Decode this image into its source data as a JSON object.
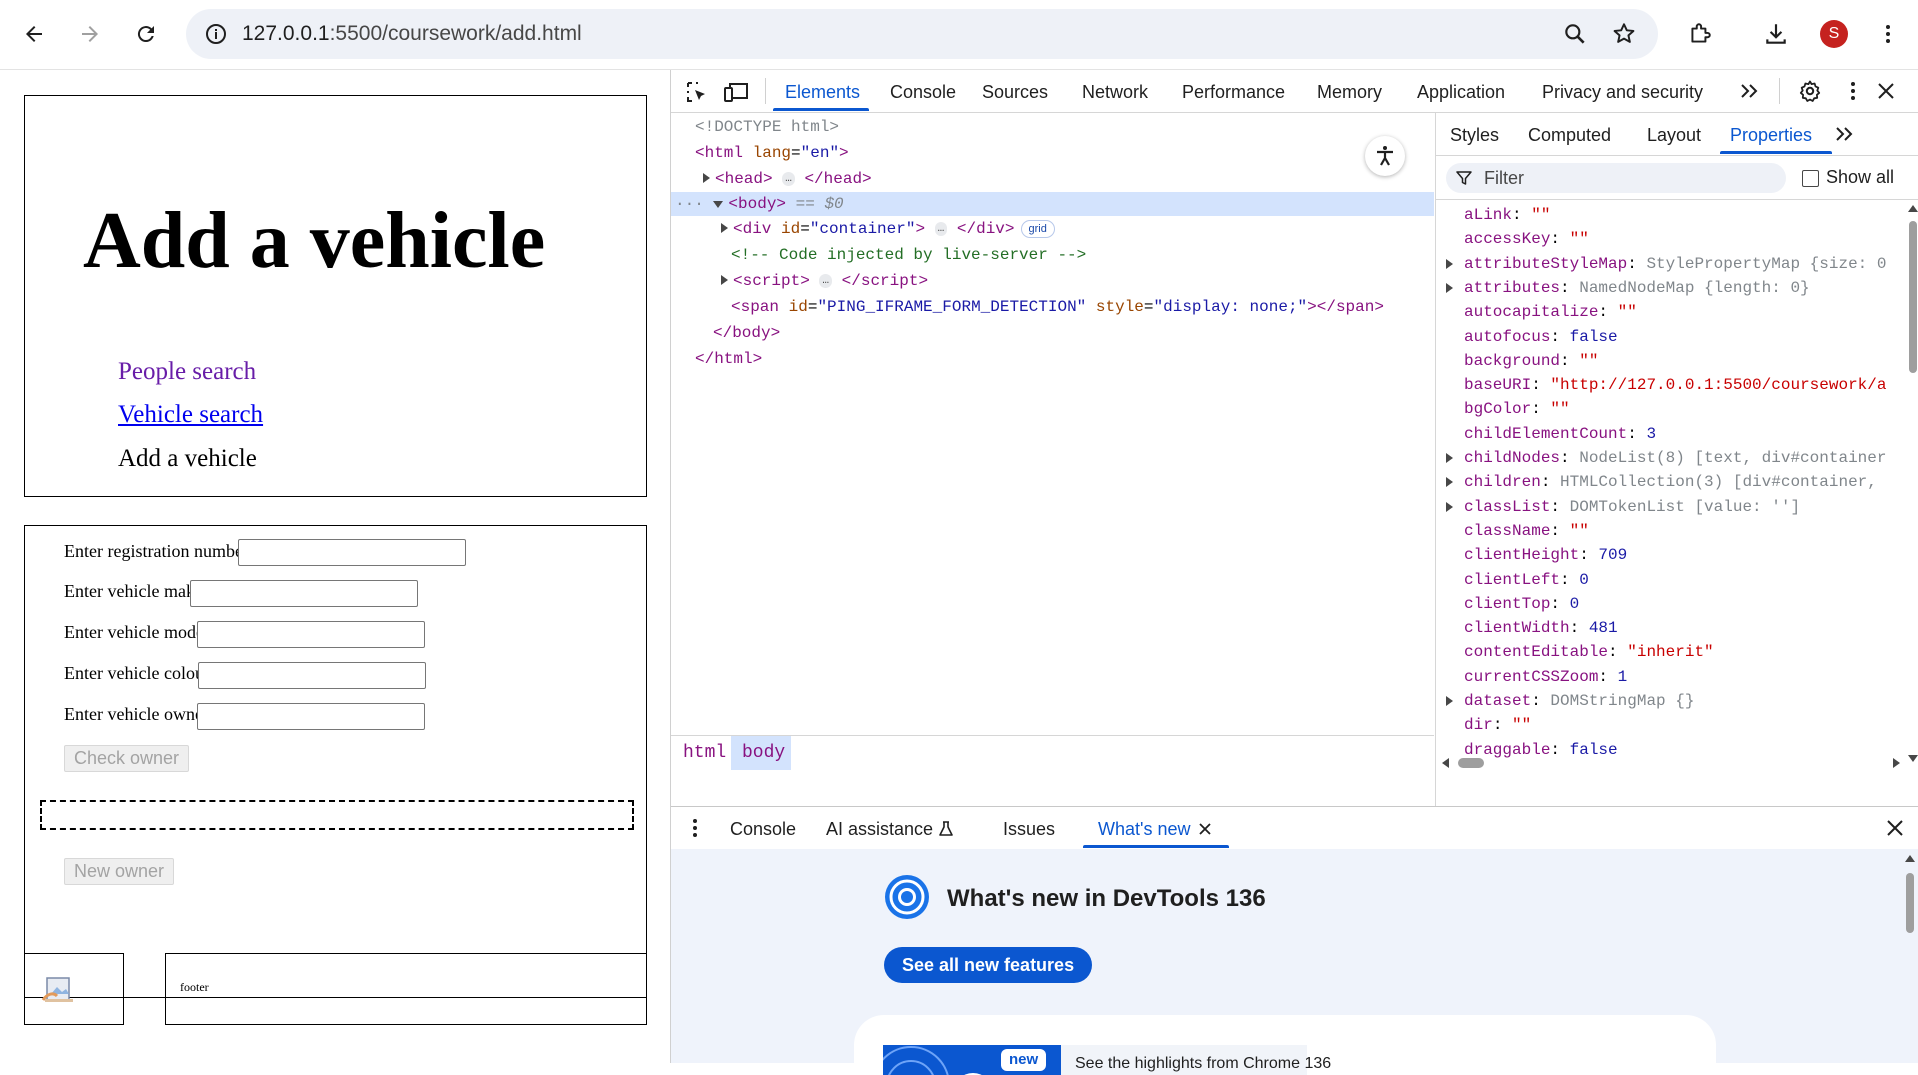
{
  "browser": {
    "url_host": "127.0.0.1",
    "url_path": ":5500/coursework/add.html",
    "profile_initial": "S"
  },
  "page": {
    "title": "Add a vehicle",
    "nav": {
      "people_search": "People search",
      "vehicle_search": "Vehicle search",
      "add_vehicle": "Add a vehicle"
    },
    "form": {
      "registration_label": "Enter registration number",
      "make_label": "Enter vehicle make",
      "model_label": "Enter vehicle model",
      "colour_label": "Enter vehicle colour",
      "owner_label": "Enter vehicle owner",
      "check_owner_button": "Check owner",
      "new_owner_button": "New owner"
    },
    "footer_text": "footer"
  },
  "devtools": {
    "tabs": [
      "Elements",
      "Console",
      "Sources",
      "Network",
      "Performance",
      "Memory",
      "Application",
      "Privacy and security"
    ],
    "active_tab": "Elements",
    "dom": {
      "doctype": "<!DOCTYPE html>",
      "body_marker": "== $0",
      "comment": "<!-- Code injected by live-server -->",
      "grid_badge": "grid",
      "ellipsis": "…"
    },
    "breadcrumbs": [
      "html",
      "body"
    ],
    "sidebar_tabs": [
      "Styles",
      "Computed",
      "Layout",
      "Properties"
    ],
    "active_sidebar_tab": "Properties",
    "filter_placeholder": "Filter",
    "show_all_label": "Show all",
    "properties": [
      {
        "key": "aLink",
        "value": "\"\"",
        "kind": "string"
      },
      {
        "key": "accessKey",
        "value": "\"\"",
        "kind": "string"
      },
      {
        "key": "attributeStyleMap",
        "value": "StylePropertyMap {size: 0",
        "kind": "object"
      },
      {
        "key": "attributes",
        "value": "NamedNodeMap {length: 0}",
        "kind": "object"
      },
      {
        "key": "autocapitalize",
        "value": "\"\"",
        "kind": "string"
      },
      {
        "key": "autofocus",
        "value": "false",
        "kind": "bool"
      },
      {
        "key": "background",
        "value": "\"\"",
        "kind": "string"
      },
      {
        "key": "baseURI",
        "value": "\"http://127.0.0.1:5500/coursework/a",
        "kind": "string"
      },
      {
        "key": "bgColor",
        "value": "\"\"",
        "kind": "string"
      },
      {
        "key": "childElementCount",
        "value": "3",
        "kind": "number"
      },
      {
        "key": "childNodes",
        "value": "NodeList(8) [text, div#container",
        "kind": "object"
      },
      {
        "key": "children",
        "value": "HTMLCollection(3) [div#container,",
        "kind": "object"
      },
      {
        "key": "classList",
        "value": "DOMTokenList [value: '']",
        "kind": "object"
      },
      {
        "key": "className",
        "value": "\"\"",
        "kind": "string"
      },
      {
        "key": "clientHeight",
        "value": "709",
        "kind": "number"
      },
      {
        "key": "clientLeft",
        "value": "0",
        "kind": "number"
      },
      {
        "key": "clientTop",
        "value": "0",
        "kind": "number"
      },
      {
        "key": "clientWidth",
        "value": "481",
        "kind": "number"
      },
      {
        "key": "contentEditable",
        "value": "\"inherit\"",
        "kind": "string"
      },
      {
        "key": "currentCSSZoom",
        "value": "1",
        "kind": "number"
      },
      {
        "key": "dataset",
        "value": "DOMStringMap {}",
        "kind": "object"
      },
      {
        "key": "dir",
        "value": "\"\"",
        "kind": "string"
      },
      {
        "key": "draggable",
        "value": "false",
        "kind": "bool"
      }
    ],
    "drawer": {
      "tabs": [
        "Console",
        "AI assistance",
        "Issues",
        "What's new"
      ],
      "active_tab": "What's new",
      "whats_new_title": "What's new in DevTools 136",
      "see_all_button": "See all new features",
      "new_badge": "new",
      "highlights_text": "See the highlights from Chrome 136"
    }
  }
}
